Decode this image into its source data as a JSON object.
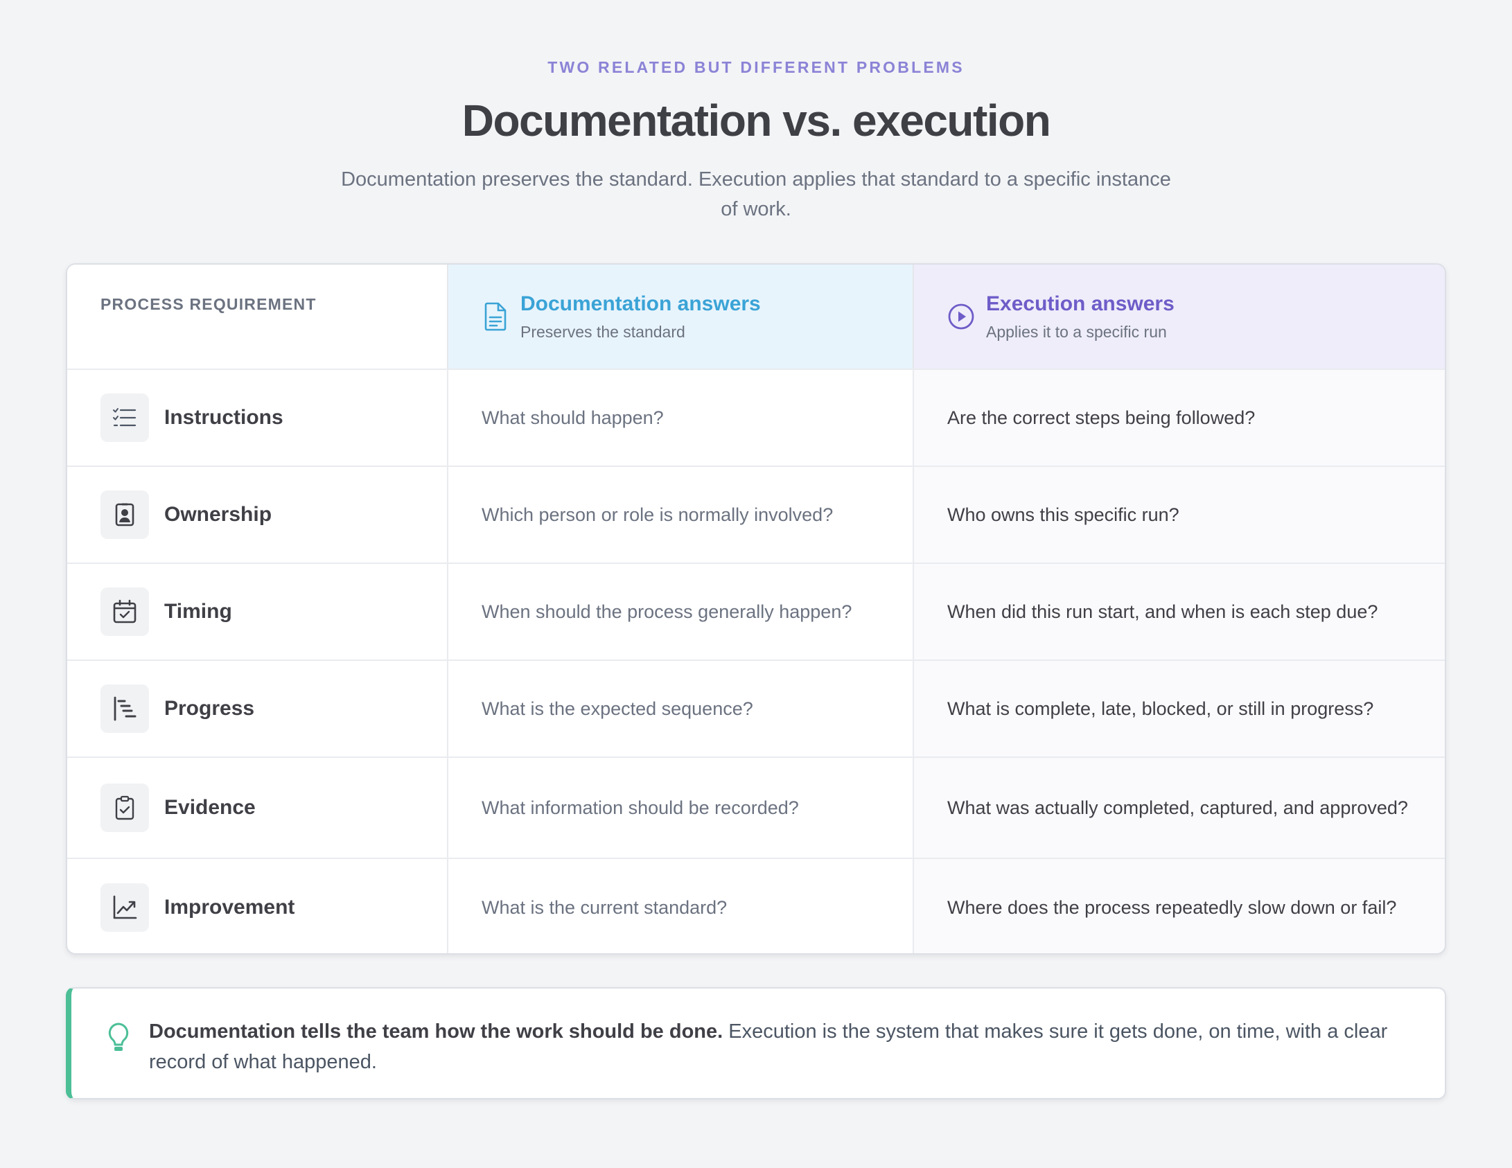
{
  "header": {
    "eyebrow": "TWO RELATED BUT DIFFERENT PROBLEMS",
    "title": "Documentation vs. execution",
    "subtitle": "Documentation preserves the standard. Execution applies that standard to a specific instance of work."
  },
  "table": {
    "column_headers": {
      "requirement": "PROCESS REQUIREMENT",
      "documentation": {
        "title": "Documentation answers",
        "subtitle": "Preserves the standard",
        "icon": "document-icon"
      },
      "execution": {
        "title": "Execution answers",
        "subtitle": "Applies it to a specific run",
        "icon": "play-circle-icon"
      }
    },
    "rows": [
      {
        "label": "Instructions",
        "icon": "checklist-icon",
        "documentation": "What should happen?",
        "execution": "Are the correct steps being followed?"
      },
      {
        "label": "Ownership",
        "icon": "id-badge-icon",
        "documentation": "Which person or role is normally involved?",
        "execution": "Who owns this specific run?"
      },
      {
        "label": "Timing",
        "icon": "calendar-check-icon",
        "documentation": "When should the process generally happen?",
        "execution": "When did this run start, and when is each step due?"
      },
      {
        "label": "Progress",
        "icon": "gantt-icon",
        "documentation": "What is the expected sequence?",
        "execution": "What is complete, late, blocked, or still in progress?"
      },
      {
        "label": "Evidence",
        "icon": "clipboard-check-icon",
        "documentation": "What information should be recorded?",
        "execution": "What was actually completed, captured, and approved?"
      },
      {
        "label": "Improvement",
        "icon": "trend-chart-icon",
        "documentation": "What is the current standard?",
        "execution": "Where does the process repeatedly slow down or fail?"
      }
    ]
  },
  "callout": {
    "icon": "lightbulb-icon",
    "bold": "Documentation tells the team how the work should be done.",
    "text": " Execution is the system that makes sure it gets done, on time, with a clear record of what happened."
  },
  "colors": {
    "accent_purple": "#6e5cc8",
    "accent_blue": "#3aa3d6",
    "accent_green": "#4cbf97"
  }
}
